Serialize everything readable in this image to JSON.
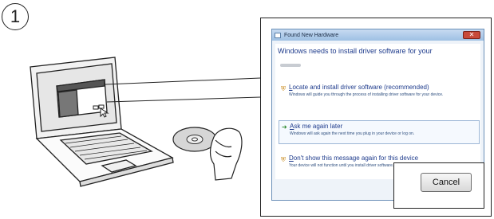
{
  "step_number": "1",
  "dialog": {
    "title": "Found New Hardware",
    "heading": "Windows needs to install driver software for your",
    "close_icon": "close-icon",
    "options": [
      {
        "icon": "shield-icon",
        "accel": "L",
        "rest": "ocate and install driver software (recommended)",
        "desc": "Windows will guide you through the process of installing driver software for your device."
      },
      {
        "icon": "arrow-right-icon",
        "accel": "A",
        "rest": "sk me again later",
        "desc": "Windows will ask again the next time you plug in your device or log on."
      },
      {
        "icon": "shield-icon",
        "accel": "D",
        "rest": "on't show this message again for this device",
        "desc": "Your device will not function until you install driver software."
      }
    ]
  },
  "cancel_label": "Cancel",
  "colors": {
    "dialog_accent": "#1e3b8c",
    "titlebar": "#9ec0e4",
    "close_button": "#c84a3a"
  }
}
